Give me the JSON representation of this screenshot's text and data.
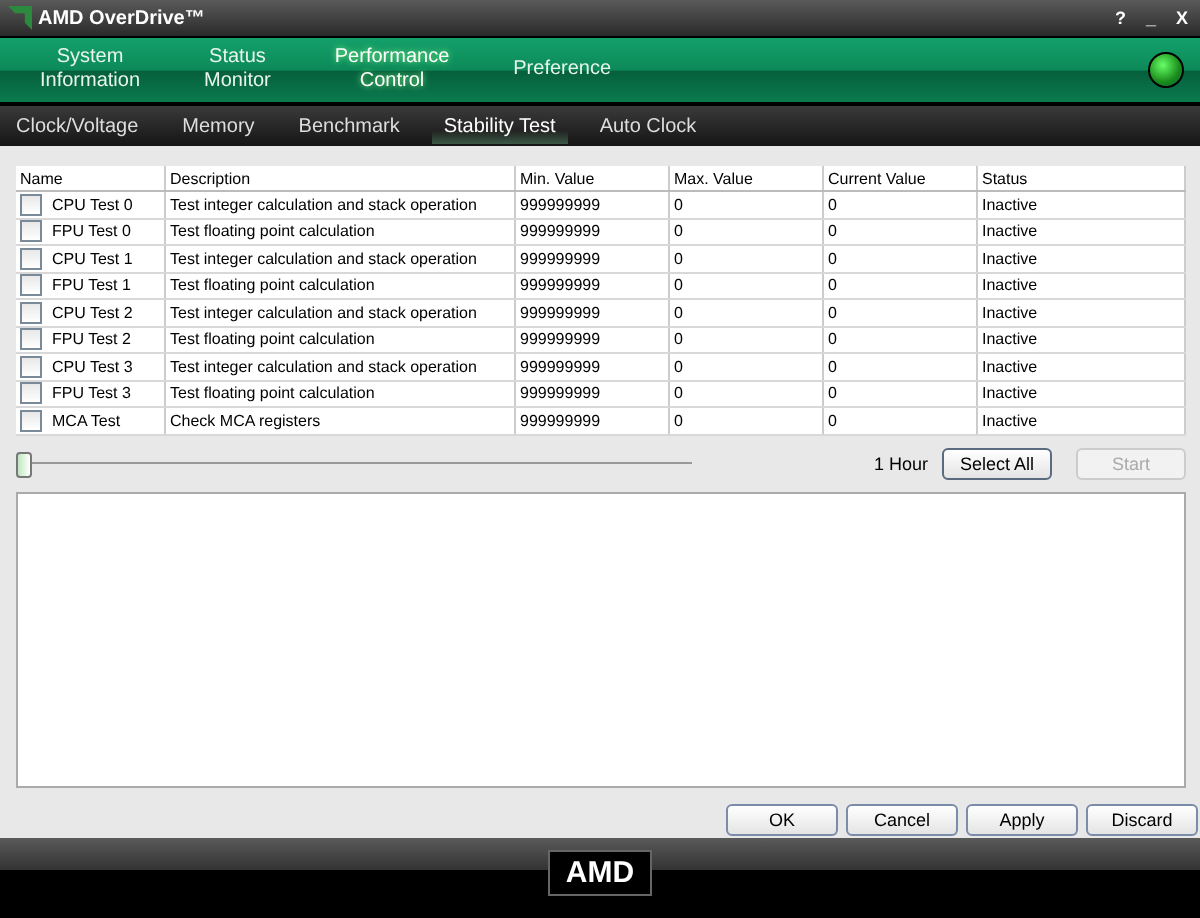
{
  "window": {
    "title": "AMD OverDrive™",
    "controls": [
      "?",
      "_",
      "X"
    ]
  },
  "nav": [
    {
      "label": "System\nInformation",
      "selected": false
    },
    {
      "label": "Status\nMonitor",
      "selected": false
    },
    {
      "label": "Performance\nControl",
      "selected": true
    },
    {
      "label": "Preference",
      "selected": false
    }
  ],
  "subtabs": [
    {
      "label": "Clock/Voltage",
      "selected": false
    },
    {
      "label": "Memory",
      "selected": false
    },
    {
      "label": "Benchmark",
      "selected": false
    },
    {
      "label": "Stability Test",
      "selected": true
    },
    {
      "label": "Auto Clock",
      "selected": false
    }
  ],
  "table": {
    "columns": [
      "Name",
      "Description",
      "Min. Value",
      "Max. Value",
      "Current Value",
      "Status"
    ],
    "rows": [
      {
        "checked": false,
        "cells": [
          "CPU Test 0",
          "Test integer calculation and stack operation",
          "999999999",
          "0",
          "0",
          "Inactive"
        ]
      },
      {
        "checked": false,
        "cells": [
          "FPU Test 0",
          "Test floating point calculation",
          "999999999",
          "0",
          "0",
          "Inactive"
        ]
      },
      {
        "checked": false,
        "cells": [
          "CPU Test 1",
          "Test integer calculation and stack operation",
          "999999999",
          "0",
          "0",
          "Inactive"
        ]
      },
      {
        "checked": false,
        "cells": [
          "FPU Test 1",
          "Test floating point calculation",
          "999999999",
          "0",
          "0",
          "Inactive"
        ]
      },
      {
        "checked": false,
        "cells": [
          "CPU Test 2",
          "Test integer calculation and stack operation",
          "999999999",
          "0",
          "0",
          "Inactive"
        ]
      },
      {
        "checked": false,
        "cells": [
          "FPU Test 2",
          "Test floating point calculation",
          "999999999",
          "0",
          "0",
          "Inactive"
        ]
      },
      {
        "checked": false,
        "cells": [
          "CPU Test 3",
          "Test integer calculation and stack operation",
          "999999999",
          "0",
          "0",
          "Inactive"
        ]
      },
      {
        "checked": false,
        "cells": [
          "FPU Test 3",
          "Test floating point calculation",
          "999999999",
          "0",
          "0",
          "Inactive"
        ]
      },
      {
        "checked": false,
        "cells": [
          "MCA Test",
          "Check MCA registers",
          "999999999",
          "0",
          "0",
          "Inactive"
        ]
      }
    ]
  },
  "duration": {
    "level": 0,
    "reading": "1 Hour"
  },
  "test_buttons": [
    {
      "label": "Select All",
      "disabled": false
    },
    {
      "label": "Start",
      "disabled": true
    }
  ],
  "dialog_buttons": [
    "OK",
    "Cancel",
    "Apply",
    "Discard"
  ],
  "footer": {
    "logo": "AMD"
  }
}
